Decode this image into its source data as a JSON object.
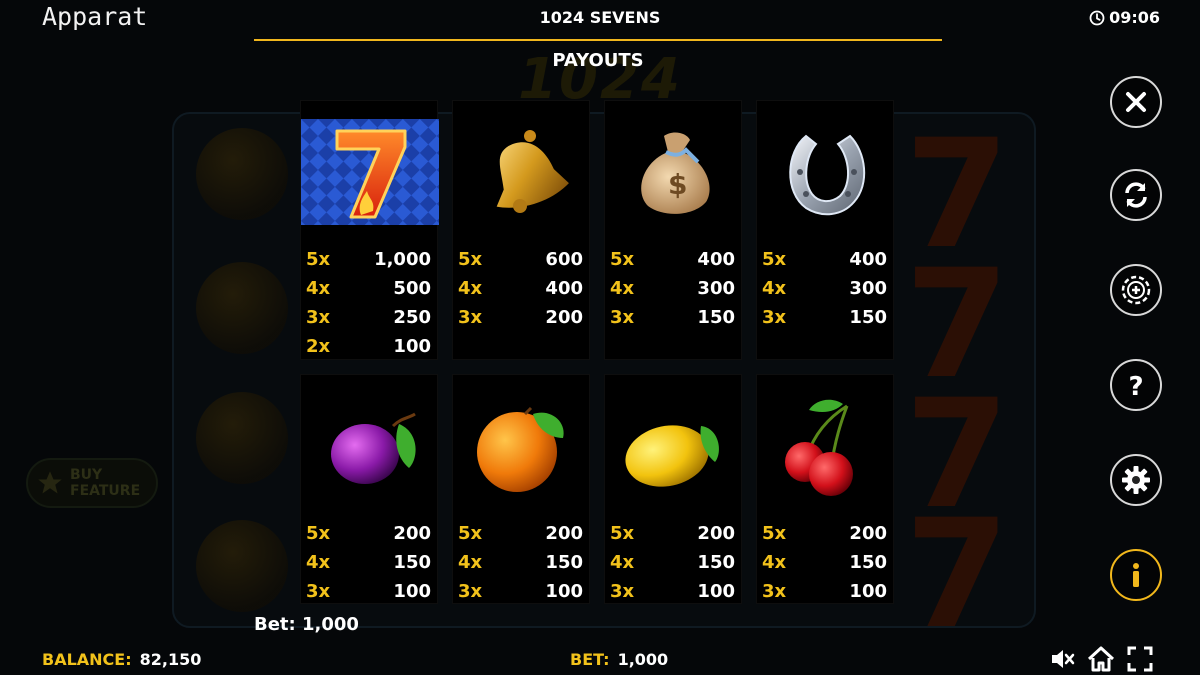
{
  "header": {
    "brand": "Apparat",
    "game_title": "1024 SEVENS",
    "clock": "09:06"
  },
  "overlay": {
    "heading": "PAYOUTS",
    "bet_line": "Bet: 1,000"
  },
  "background": {
    "logo_text": "1024 SEVENS",
    "buy_feature_label": "BUY FEATURE"
  },
  "symbols": [
    {
      "icon": "seven-symbol-icon",
      "payouts": [
        {
          "mult": "5x",
          "amount": "1,000"
        },
        {
          "mult": "4x",
          "amount": "500"
        },
        {
          "mult": "3x",
          "amount": "250"
        },
        {
          "mult": "2x",
          "amount": "100"
        }
      ]
    },
    {
      "icon": "bell-symbol-icon",
      "payouts": [
        {
          "mult": "5x",
          "amount": "600"
        },
        {
          "mult": "4x",
          "amount": "400"
        },
        {
          "mult": "3x",
          "amount": "200"
        }
      ]
    },
    {
      "icon": "money-bag-symbol-icon",
      "payouts": [
        {
          "mult": "5x",
          "amount": "400"
        },
        {
          "mult": "4x",
          "amount": "300"
        },
        {
          "mult": "3x",
          "amount": "150"
        }
      ]
    },
    {
      "icon": "horseshoe-symbol-icon",
      "payouts": [
        {
          "mult": "5x",
          "amount": "400"
        },
        {
          "mult": "4x",
          "amount": "300"
        },
        {
          "mult": "3x",
          "amount": "150"
        }
      ]
    },
    {
      "icon": "plum-symbol-icon",
      "payouts": [
        {
          "mult": "5x",
          "amount": "200"
        },
        {
          "mult": "4x",
          "amount": "150"
        },
        {
          "mult": "3x",
          "amount": "100"
        }
      ]
    },
    {
      "icon": "orange-symbol-icon",
      "payouts": [
        {
          "mult": "5x",
          "amount": "200"
        },
        {
          "mult": "4x",
          "amount": "150"
        },
        {
          "mult": "3x",
          "amount": "100"
        }
      ]
    },
    {
      "icon": "lemon-symbol-icon",
      "payouts": [
        {
          "mult": "5x",
          "amount": "200"
        },
        {
          "mult": "4x",
          "amount": "150"
        },
        {
          "mult": "3x",
          "amount": "100"
        }
      ]
    },
    {
      "icon": "cherries-symbol-icon",
      "payouts": [
        {
          "mult": "5x",
          "amount": "200"
        },
        {
          "mult": "4x",
          "amount": "150"
        },
        {
          "mult": "3x",
          "amount": "100"
        }
      ]
    }
  ],
  "footer": {
    "balance_label": "BALANCE:",
    "balance_value": "82,150",
    "bet_label": "BET:",
    "bet_value": "1,000"
  },
  "side_buttons": [
    "close-icon",
    "autoplay-icon",
    "bet-chip-icon",
    "help-icon",
    "settings-icon",
    "info-icon"
  ],
  "bottom_icons": [
    "sound-muted-icon",
    "home-icon",
    "fullscreen-icon"
  ],
  "colors": {
    "accent": "#f2c21b",
    "line": "#f1b61d",
    "background": "#050709"
  }
}
